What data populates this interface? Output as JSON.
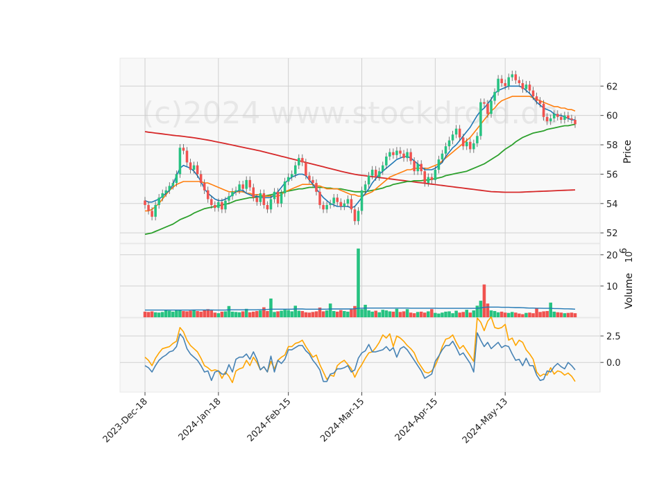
{
  "chart_data": {
    "type": "candlestick",
    "watermark": "(c)2024 www.stockdroid.de",
    "x_tick_labels": [
      "2023-Dec-18",
      "2024-Jan-18",
      "2024-Feb-15",
      "2024-Mar-15",
      "2024-Apr-15",
      "2024-May-13"
    ],
    "x_tick_positions": [
      0,
      21,
      41,
      62,
      83,
      103
    ],
    "price_panel": {
      "ylabel": "Price",
      "ylim": [
        51.3,
        63.9
      ],
      "yticks": [
        52,
        54,
        56,
        58,
        60,
        62
      ],
      "close": [
        53.9,
        53.5,
        53.1,
        53.9,
        54.4,
        54.7,
        54.9,
        55.2,
        55.4,
        56.0,
        57.8,
        57.6,
        56.8,
        56.3,
        56.6,
        56.0,
        55.4,
        54.9,
        54.3,
        53.9,
        53.7,
        54.1,
        53.6,
        54.2,
        54.5,
        54.8,
        54.9,
        55.3,
        55.0,
        55.6,
        55.1,
        54.4,
        54.1,
        54.7,
        53.9,
        53.6,
        54.3,
        54.8,
        54.0,
        54.7,
        55.5,
        55.8,
        56.0,
        56.6,
        57.1,
        56.8,
        55.9,
        55.6,
        55.4,
        54.8,
        53.9,
        53.6,
        53.9,
        54.0,
        54.4,
        54.1,
        53.8,
        54.0,
        54.3,
        53.6,
        52.8,
        53.5,
        54.9,
        55.3,
        55.9,
        56.3,
        55.8,
        56.2,
        56.6,
        57.2,
        57.5,
        57.3,
        57.6,
        57.4,
        57.1,
        57.5,
        56.9,
        56.2,
        56.7,
        56.2,
        55.4,
        55.8,
        55.6,
        56.3,
        57.0,
        57.4,
        57.9,
        58.3,
        58.7,
        59.1,
        58.5,
        57.9,
        58.2,
        57.7,
        58.1,
        58.6,
        60.9,
        60.8,
        60.1,
        61.0,
        61.6,
        62.5,
        62.2,
        62.0,
        62.6,
        62.8,
        62.4,
        62.2,
        61.8,
        62.1,
        61.7,
        61.3,
        61.0,
        60.8,
        59.9,
        59.6,
        59.8,
        60.1,
        59.9,
        59.7,
        60.0,
        59.8,
        59.7,
        59.4
      ],
      "ma_short": [
        54.2,
        54.1,
        54.1,
        54.2,
        54.3,
        54.5,
        54.7,
        54.9,
        55.3,
        55.9,
        56.4,
        56.6,
        56.5,
        56.4,
        56.2,
        55.9,
        55.5,
        55.0,
        54.7,
        54.5,
        54.3,
        54.2,
        54.2,
        54.3,
        54.4,
        54.6,
        54.8,
        54.9,
        54.9,
        54.7,
        54.6,
        54.5,
        54.5,
        54.4,
        54.4,
        54.4,
        54.4,
        54.6,
        54.8,
        55.1,
        55.4,
        55.6,
        55.8,
        55.9,
        56.0,
        56.0,
        55.9,
        55.6,
        55.3,
        55.0,
        54.7,
        54.4,
        54.2,
        54.0,
        53.9,
        53.8,
        53.8,
        53.8,
        53.8,
        53.7,
        53.8,
        54.1,
        54.4,
        54.7,
        55.0,
        55.4,
        55.7,
        56.0,
        56.2,
        56.4,
        56.6,
        56.8,
        57.0,
        57.1,
        57.2,
        57.2,
        57.1,
        56.9,
        56.7,
        56.5,
        56.3,
        56.3,
        56.3,
        56.4,
        56.6,
        56.8,
        57.2,
        57.5,
        57.8,
        58.0,
        58.3,
        58.6,
        58.9,
        59.2,
        59.6,
        60.0,
        60.3,
        60.5,
        60.8,
        61.1,
        61.5,
        61.7,
        61.8,
        61.9,
        62.0,
        62.0,
        62.0,
        62.0,
        61.9,
        61.7,
        61.5,
        61.2,
        60.9,
        60.7,
        60.5,
        60.4,
        60.3,
        60.1,
        60.0,
        60.0,
        59.9,
        59.8,
        59.7,
        59.7
      ],
      "ma_mid": [
        53.5,
        53.5,
        53.6,
        53.8,
        54.0,
        54.3,
        54.6,
        54.9,
        55.1,
        55.3,
        55.4,
        55.5,
        55.5,
        55.5,
        55.5,
        55.5,
        55.5,
        55.4,
        55.4,
        55.3,
        55.2,
        55.1,
        55.0,
        54.9,
        54.8,
        54.8,
        54.8,
        54.8,
        54.8,
        54.7,
        54.7,
        54.6,
        54.6,
        54.6,
        54.5,
        54.5,
        54.5,
        54.5,
        54.5,
        54.6,
        54.8,
        54.9,
        55.0,
        55.1,
        55.2,
        55.3,
        55.3,
        55.3,
        55.3,
        55.2,
        55.2,
        55.1,
        55.0,
        55.0,
        55.0,
        55.0,
        54.9,
        54.8,
        54.7,
        54.6,
        54.6,
        54.5,
        54.5,
        54.6,
        54.7,
        54.8,
        55.0,
        55.2,
        55.4,
        55.6,
        55.8,
        55.9,
        56.0,
        56.1,
        56.2,
        56.3,
        56.3,
        56.4,
        56.4,
        56.4,
        56.4,
        56.4,
        56.5,
        56.6,
        56.7,
        56.9,
        57.1,
        57.3,
        57.5,
        57.7,
        57.9,
        58.1,
        58.3,
        58.5,
        58.8,
        59.1,
        59.4,
        59.7,
        60.0,
        60.3,
        60.5,
        60.8,
        61.0,
        61.1,
        61.2,
        61.3,
        61.3,
        61.3,
        61.3,
        61.3,
        61.3,
        61.2,
        61.1,
        61.0,
        60.9,
        60.8,
        60.7,
        60.6,
        60.6,
        60.5,
        60.5,
        60.4,
        60.4,
        60.3
      ],
      "ma_long_green": [
        51.9,
        51.95,
        52.0,
        52.1,
        52.2,
        52.3,
        52.4,
        52.5,
        52.6,
        52.75,
        52.9,
        53.0,
        53.1,
        53.2,
        53.35,
        53.45,
        53.55,
        53.65,
        53.7,
        53.75,
        53.8,
        53.85,
        53.9,
        53.95,
        54.0,
        54.1,
        54.2,
        54.25,
        54.3,
        54.35,
        54.4,
        54.4,
        54.45,
        54.5,
        54.5,
        54.55,
        54.6,
        54.65,
        54.7,
        54.75,
        54.8,
        54.85,
        54.9,
        54.95,
        55.0,
        55.0,
        55.05,
        55.1,
        55.1,
        55.1,
        55.1,
        55.1,
        55.05,
        55.05,
        55.0,
        55.0,
        55.0,
        54.95,
        54.9,
        54.85,
        54.8,
        54.8,
        54.8,
        54.8,
        54.85,
        54.9,
        54.95,
        55.0,
        55.05,
        55.15,
        55.2,
        55.3,
        55.35,
        55.4,
        55.45,
        55.5,
        55.5,
        55.55,
        55.55,
        55.55,
        55.6,
        55.6,
        55.65,
        55.7,
        55.75,
        55.8,
        55.9,
        55.95,
        56.0,
        56.05,
        56.1,
        56.15,
        56.2,
        56.3,
        56.4,
        56.5,
        56.6,
        56.7,
        56.85,
        57.0,
        57.15,
        57.3,
        57.5,
        57.7,
        57.85,
        58.0,
        58.2,
        58.35,
        58.5,
        58.6,
        58.7,
        58.8,
        58.85,
        58.9,
        58.95,
        59.05,
        59.1,
        59.15,
        59.2,
        59.25,
        59.3,
        59.3,
        59.35,
        59.4
      ],
      "ma_long_red": [
        58.9,
        58.86,
        58.83,
        58.8,
        58.77,
        58.74,
        58.71,
        58.68,
        58.65,
        58.62,
        58.6,
        58.57,
        58.54,
        58.51,
        58.48,
        58.44,
        58.4,
        58.36,
        58.32,
        58.28,
        58.23,
        58.18,
        58.13,
        58.08,
        58.03,
        57.98,
        57.93,
        57.88,
        57.83,
        57.78,
        57.73,
        57.68,
        57.63,
        57.58,
        57.52,
        57.46,
        57.4,
        57.34,
        57.28,
        57.22,
        57.16,
        57.1,
        57.04,
        56.98,
        56.92,
        56.86,
        56.8,
        56.74,
        56.68,
        56.62,
        56.56,
        56.5,
        56.44,
        56.38,
        56.32,
        56.26,
        56.2,
        56.14,
        56.09,
        56.04,
        55.99,
        55.95,
        55.92,
        55.89,
        55.86,
        55.83,
        55.8,
        55.77,
        55.74,
        55.71,
        55.68,
        55.65,
        55.62,
        55.59,
        55.56,
        55.53,
        55.5,
        55.47,
        55.44,
        55.41,
        55.38,
        55.35,
        55.32,
        55.29,
        55.26,
        55.23,
        55.2,
        55.17,
        55.14,
        55.11,
        55.08,
        55.05,
        55.02,
        54.99,
        54.96,
        54.93,
        54.9,
        54.87,
        54.84,
        54.81,
        54.8,
        54.79,
        54.78,
        54.77,
        54.77,
        54.77,
        54.77,
        54.77,
        54.78,
        54.79,
        54.8,
        54.81,
        54.82,
        54.83,
        54.84,
        54.85,
        54.86,
        54.87,
        54.88,
        54.89,
        54.9,
        54.91,
        54.92,
        54.93
      ]
    },
    "volume_panel": {
      "ylabel": "Volume",
      "unit_exponent": "10^6",
      "ylim": [
        0,
        23.5
      ],
      "yticks": [
        10,
        20
      ],
      "volume": [
        1.8,
        1.7,
        1.9,
        1.6,
        1.5,
        1.7,
        2.3,
        2.1,
        1.8,
        2.2,
        2.4,
        2.0,
        1.9,
        2.1,
        2.3,
        2.0,
        1.8,
        2.4,
        2.6,
        2.2,
        1.5,
        1.3,
        1.8,
        1.9,
        3.6,
        1.8,
        1.7,
        1.6,
        1.9,
        2.7,
        1.6,
        1.8,
        2.0,
        2.2,
        3.2,
        2.0,
        6.0,
        1.7,
        1.9,
        2.1,
        2.4,
        2.3,
        1.9,
        3.7,
        2.1,
        2.0,
        1.6,
        1.5,
        1.7,
        1.9,
        3.1,
        1.9,
        2.2,
        4.4,
        2.0,
        1.8,
        2.3,
        2.0,
        1.8,
        2.5,
        3.6,
        22.0,
        2.6,
        4.0,
        2.2,
        1.8,
        2.1,
        1.6,
        2.4,
        2.2,
        1.9,
        1.8,
        2.7,
        1.7,
        1.9,
        2.6,
        1.5,
        1.3,
        1.7,
        1.8,
        1.5,
        1.9,
        2.6,
        1.4,
        1.2,
        1.5,
        1.8,
        1.9,
        1.3,
        2.1,
        1.5,
        1.7,
        2.4,
        1.5,
        2.2,
        3.7,
        5.3,
        10.5,
        4.4,
        2.2,
        2.0,
        1.6,
        1.8,
        1.5,
        1.4,
        1.7,
        1.5,
        1.2,
        1.0,
        1.4,
        1.5,
        1.3,
        2.8,
        1.7,
        1.9,
        2.0,
        4.7,
        1.8,
        1.6,
        1.5,
        1.3,
        1.4,
        1.5,
        1.3
      ],
      "volume_ma": [
        2.3,
        2.3,
        2.3,
        2.3,
        2.3,
        2.3,
        2.3,
        2.3,
        2.3,
        2.3,
        2.3,
        2.3,
        2.3,
        2.3,
        2.35,
        2.35,
        2.35,
        2.35,
        2.35,
        2.35,
        2.3,
        2.3,
        2.3,
        2.3,
        2.4,
        2.4,
        2.4,
        2.4,
        2.4,
        2.4,
        2.4,
        2.4,
        2.4,
        2.45,
        2.45,
        2.5,
        2.6,
        2.6,
        2.6,
        2.6,
        2.6,
        2.6,
        2.6,
        2.65,
        2.65,
        2.65,
        2.6,
        2.6,
        2.6,
        2.6,
        2.6,
        2.6,
        2.6,
        2.65,
        2.65,
        2.65,
        2.65,
        2.65,
        2.65,
        2.65,
        2.7,
        2.9,
        2.9,
        2.95,
        2.95,
        2.95,
        2.95,
        2.95,
        2.95,
        2.95,
        2.95,
        2.95,
        2.95,
        2.95,
        2.95,
        2.95,
        2.9,
        2.9,
        2.9,
        2.9,
        2.9,
        2.9,
        2.9,
        2.9,
        2.85,
        2.85,
        2.85,
        2.85,
        2.85,
        2.85,
        2.85,
        2.85,
        2.85,
        2.85,
        2.85,
        2.9,
        3.0,
        3.2,
        3.25,
        3.25,
        3.25,
        3.25,
        3.2,
        3.2,
        3.2,
        3.15,
        3.1,
        3.1,
        3.05,
        3.0,
        2.95,
        2.95,
        2.9,
        2.9,
        2.85,
        2.85,
        2.85,
        2.8,
        2.8,
        2.75,
        2.7,
        2.7,
        2.65,
        2.6
      ]
    },
    "indicator_panel": {
      "ylim": [
        -2.8,
        4.2
      ],
      "yticks": [
        -0.0,
        2.5
      ],
      "ytick_labels": [
        "0.0",
        "2.5"
      ],
      "line_blue": [
        -0.3,
        -0.5,
        -0.9,
        -0.3,
        0.2,
        0.5,
        0.7,
        1.0,
        1.1,
        1.5,
        2.7,
        2.3,
        1.3,
        0.8,
        0.5,
        0.2,
        -0.3,
        -0.9,
        -0.8,
        -1.7,
        -0.9,
        -0.8,
        -1.1,
        -1.1,
        -0.2,
        -0.9,
        0.3,
        0.5,
        0.5,
        0.8,
        0.3,
        1.0,
        0.3,
        -0.7,
        -0.4,
        -0.9,
        0.6,
        -0.9,
        0.2,
        -0.1,
        0.3,
        1.2,
        1.2,
        1.4,
        1.6,
        1.6,
        1.1,
        0.8,
        0.2,
        -0.2,
        -0.7,
        -1.8,
        -1.8,
        -1.1,
        -1.0,
        -0.6,
        -0.6,
        -0.5,
        -0.3,
        -0.9,
        -0.7,
        0.4,
        0.9,
        1.1,
        1.7,
        1.0,
        1.0,
        1.1,
        1.2,
        1.5,
        1.1,
        1.4,
        0.5,
        1.3,
        1.5,
        1.2,
        0.7,
        0.2,
        -0.3,
        -0.8,
        -1.5,
        -1.3,
        -1.1,
        0.1,
        0.6,
        1.2,
        1.6,
        1.6,
        2.0,
        1.4,
        0.7,
        0.9,
        0.4,
        -0.1,
        -0.9,
        2.8,
        2.1,
        1.5,
        1.9,
        1.3,
        1.6,
        1.9,
        1.4,
        1.6,
        1.5,
        0.8,
        0.2,
        0.3,
        -0.3,
        0.4,
        -0.3,
        -0.3,
        -1.2,
        -1.7,
        -1.6,
        -0.8,
        -0.9,
        -0.4,
        -0.1,
        -0.4,
        -0.6,
        0.0,
        -0.3,
        -0.7
      ],
      "line_orange": [
        0.5,
        0.2,
        -0.3,
        0.4,
        0.9,
        1.3,
        1.4,
        1.5,
        1.8,
        2.0,
        3.3,
        2.9,
        2.1,
        1.6,
        1.3,
        1.0,
        0.4,
        -0.3,
        -0.5,
        -0.8,
        -0.7,
        -0.8,
        -1.5,
        -0.9,
        -1.3,
        -1.9,
        -0.8,
        -0.6,
        -0.5,
        0.2,
        -0.3,
        0.5,
        0.0,
        -0.7,
        -0.4,
        -0.9,
        0.1,
        -0.6,
        0.2,
        0.5,
        0.7,
        1.5,
        1.5,
        1.8,
        1.9,
        2.1,
        1.5,
        1.0,
        0.5,
        0.7,
        -0.2,
        -0.9,
        -1.6,
        -1.2,
        -1.3,
        -0.3,
        0.0,
        0.2,
        -0.2,
        -0.6,
        -1.4,
        -0.7,
        -0.2,
        0.4,
        0.9,
        1.0,
        1.4,
        1.9,
        2.6,
        2.3,
        2.7,
        1.5,
        2.5,
        2.3,
        2.0,
        1.6,
        1.3,
        0.9,
        0.1,
        -0.4,
        -0.9,
        -1.0,
        -0.8,
        -0.3,
        0.5,
        1.5,
        2.2,
        2.3,
        2.6,
        1.9,
        1.3,
        1.6,
        1.1,
        0.6,
        0.1,
        4.2,
        3.8,
        3.0,
        3.9,
        4.3,
        3.3,
        3.2,
        3.3,
        3.6,
        2.1,
        2.3,
        1.6,
        2.1,
        1.9,
        1.2,
        0.8,
        0.3,
        -0.9,
        -1.3,
        -1.1,
        -1.2,
        -0.5,
        -1.1,
        -0.8,
        -0.9,
        -1.2,
        -1.0,
        -1.3,
        -1.8
      ]
    }
  },
  "colors": {
    "candle_up": "#26c281",
    "candle_down": "#f0524f",
    "line_blue": "#1f77b4",
    "line_orange": "#ff7f0e",
    "line_green": "#2ca02c",
    "line_red": "#d62728",
    "indicator_blue": "#4682b4",
    "indicator_orange": "#ffa500",
    "panel_bg": "#f8f8f8",
    "grid": "#d0d0d0"
  }
}
